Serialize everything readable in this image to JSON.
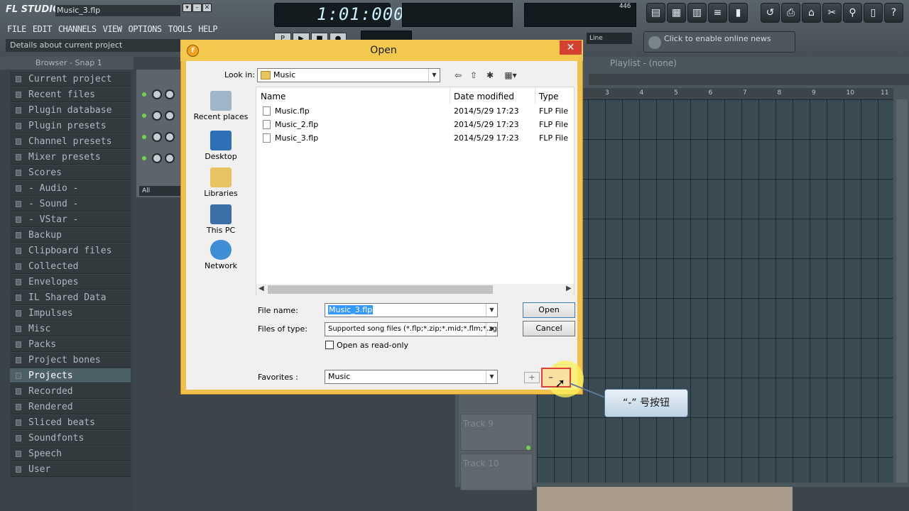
{
  "app": {
    "logo": "FL STUDIO",
    "project_title": "Music_3.flp",
    "hint": "Details about current project",
    "menu": [
      "FILE",
      "EDIT",
      "CHANNELS",
      "VIEW",
      "OPTIONS",
      "TOOLS",
      "HELP"
    ],
    "time": "1:01:000",
    "cpu_value": "446",
    "news": "Click to enable online news",
    "snap_mode": "Line",
    "all_label": "All"
  },
  "browser": {
    "header": "Browser - Snap 1",
    "items": [
      "Current project",
      "Recent files",
      "Plugin database",
      "Plugin presets",
      "Channel presets",
      "Mixer presets",
      "Scores",
      "- Audio -",
      "- Sound -",
      "- VStar -",
      "Backup",
      "Clipboard files",
      "Collected",
      "Envelopes",
      "IL Shared Data",
      "Impulses",
      "Misc",
      "Packs",
      "Project bones",
      "Projects",
      "Recorded",
      "Rendered",
      "Sliced beats",
      "Soundfonts",
      "Speech",
      "User"
    ],
    "selected": "Projects"
  },
  "playlist": {
    "title": "Playlist - (none)",
    "ruler": [
      "3",
      "4",
      "5",
      "6",
      "7",
      "8",
      "9",
      "10",
      "11"
    ],
    "tracks": [
      {
        "name": "Track 9"
      },
      {
        "name": "Track 10"
      }
    ]
  },
  "dialog": {
    "title": "Open",
    "look_in_label": "Look in:",
    "look_in_value": "Music",
    "places": [
      "Recent places",
      "Desktop",
      "Libraries",
      "This PC",
      "Network"
    ],
    "columns": [
      "Name",
      "Date modified",
      "Type"
    ],
    "files": [
      {
        "name": "Music.flp",
        "date": "2014/5/29 17:23",
        "type": "FLP File"
      },
      {
        "name": "Music_2.flp",
        "date": "2014/5/29 17:23",
        "type": "FLP File"
      },
      {
        "name": "Music_3.flp",
        "date": "2014/5/29 17:23",
        "type": "FLP File"
      }
    ],
    "file_name_label": "File name:",
    "file_name_value": "Music_3.flp",
    "files_of_type_label": "Files of type:",
    "files_of_type_value": "Supported song files (*.flp;*.zip;*.mid;*.flm;*.zgr)",
    "readonly_label": "Open as read-only",
    "favorites_label": "Favorites :",
    "favorites_value": "Music",
    "open_button": "Open",
    "cancel_button": "Cancel"
  },
  "annotation": {
    "callout_text": "“-” 号按钮"
  },
  "colors": {
    "dialog_frame": "#f0c04a",
    "close_button": "#d64030",
    "selected_text_bg": "#3399ff",
    "browser_text": "#aeb8bd"
  }
}
